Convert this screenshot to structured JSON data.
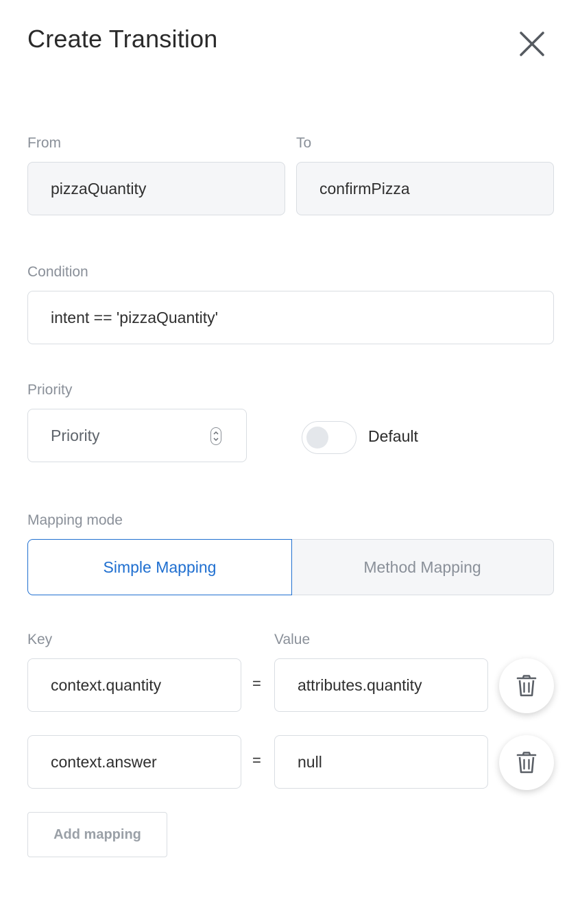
{
  "header": {
    "title": "Create Transition",
    "close_icon": "close-icon"
  },
  "from": {
    "label": "From",
    "value": "pizzaQuantity"
  },
  "to": {
    "label": "To",
    "value": "confirmPizza"
  },
  "condition": {
    "label": "Condition",
    "value": "intent == 'pizzaQuantity'"
  },
  "priority": {
    "label": "Priority",
    "placeholder": "Priority",
    "icon": "spinner-icon"
  },
  "default_toggle": {
    "label": "Default",
    "checked": false
  },
  "mapping_mode": {
    "label": "Mapping mode",
    "options": [
      "Simple Mapping",
      "Method Mapping"
    ],
    "selected": "Simple Mapping"
  },
  "mappings": {
    "key_label": "Key",
    "value_label": "Value",
    "equals": "=",
    "rows": [
      {
        "key": "context.quantity",
        "value": "attributes.quantity",
        "delete_icon": "trash-icon"
      },
      {
        "key": "context.answer",
        "value": "null",
        "delete_icon": "trash-icon"
      }
    ]
  },
  "add_mapping": {
    "label": "Add mapping"
  },
  "colors": {
    "accent": "#1f6fd0",
    "border": "#d9dde2",
    "muted": "#8a9099",
    "readonly_bg": "#f5f6f8"
  }
}
